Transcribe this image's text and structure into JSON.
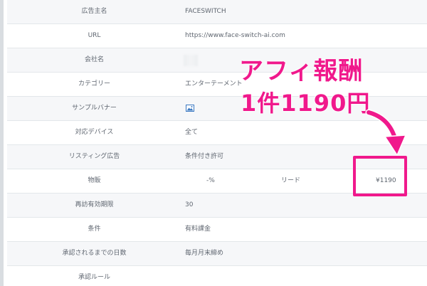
{
  "rows": [
    {
      "label": "広告主名",
      "value": "FACESWITCH"
    },
    {
      "label": "URL",
      "value": "https://www.face-switch-ai.com"
    },
    {
      "label": "会社名",
      "value": ""
    },
    {
      "label": "カテゴリー",
      "value": "エンターテーメント"
    },
    {
      "label": "サンプルバナー",
      "value": ""
    },
    {
      "label": "対応デバイス",
      "value": "全て"
    },
    {
      "label": "リスティング広告",
      "value": "条件付き許可"
    },
    {
      "label": "物販",
      "percent": "-%",
      "lead_label": "リード",
      "lead_value": "¥1190"
    },
    {
      "label": "再訪有効期限",
      "value": "30"
    },
    {
      "label": "条件",
      "value": "有料課金"
    },
    {
      "label": "承認されるまでの日数",
      "value": "毎月月末締め"
    },
    {
      "label": "承認ルール",
      "value": ""
    }
  ],
  "overlay": {
    "line1": "アフィ報酬",
    "line2": "1件1190円",
    "color": "#f0198c"
  },
  "icons": {
    "banner": "image-icon",
    "arrow": "arrow-icon"
  }
}
